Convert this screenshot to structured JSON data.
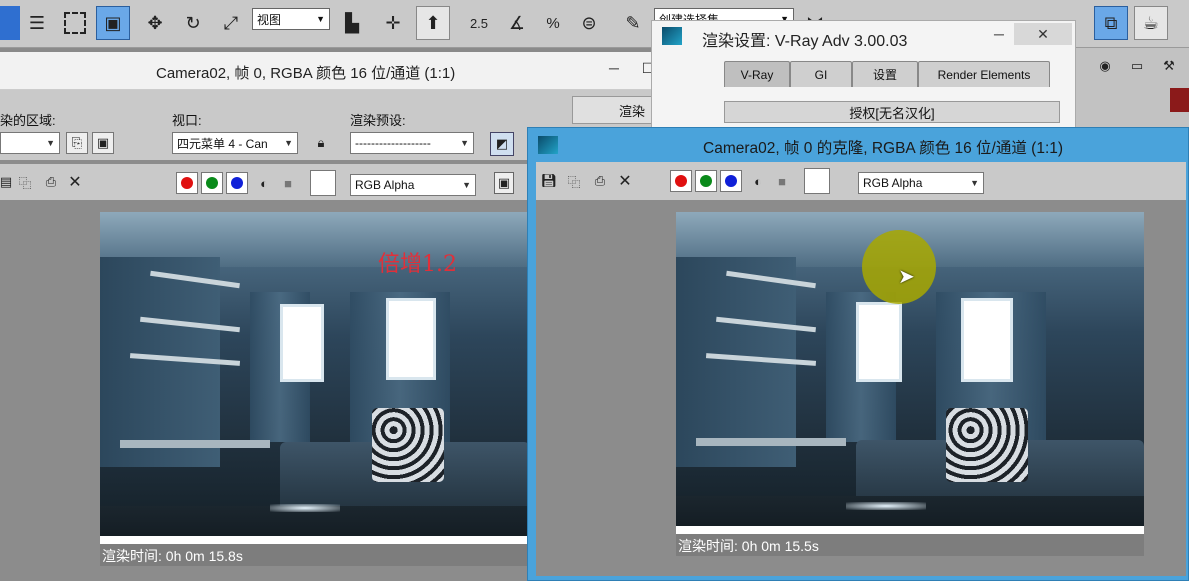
{
  "toolbar": {
    "viewport_select": "视图",
    "snap_angle": "2.5",
    "snap_percent": "%",
    "selection_set": "创建选择集"
  },
  "left_window": {
    "title": "Camera02, 帧 0, RGBA 颜色 16 位/通道 (1:1)",
    "area_label": "染的区域:",
    "viewport_label": "视口:",
    "viewport_value": "四元菜单 4 - Can",
    "preset_label": "渲染预设:",
    "preset_value": "-------------------",
    "render_button": "渲染",
    "channel_value": "RGB Alpha",
    "overlay_text": "倍增1.2",
    "render_time": "渲染时间: 0h 0m 15.8s"
  },
  "render_setup": {
    "title": "渲染设置: V-Ray Adv 3.00.03",
    "tabs": [
      "V-Ray",
      "GI",
      "设置",
      "Render Elements"
    ],
    "active_tab": "V-Ray",
    "panel_label": "授权[无名汉化]"
  },
  "clone_window": {
    "title": "Camera02, 帧 0 的克隆, RGBA 颜色 16 位/通道 (1:1)",
    "channel_value": "RGB Alpha",
    "render_time": "渲染时间: 0h 0m 15.5s"
  },
  "colors": {
    "clone_frame": "#4aa3db",
    "overlay_text": "#e0303a",
    "cursor_highlight": "#a8a800"
  }
}
